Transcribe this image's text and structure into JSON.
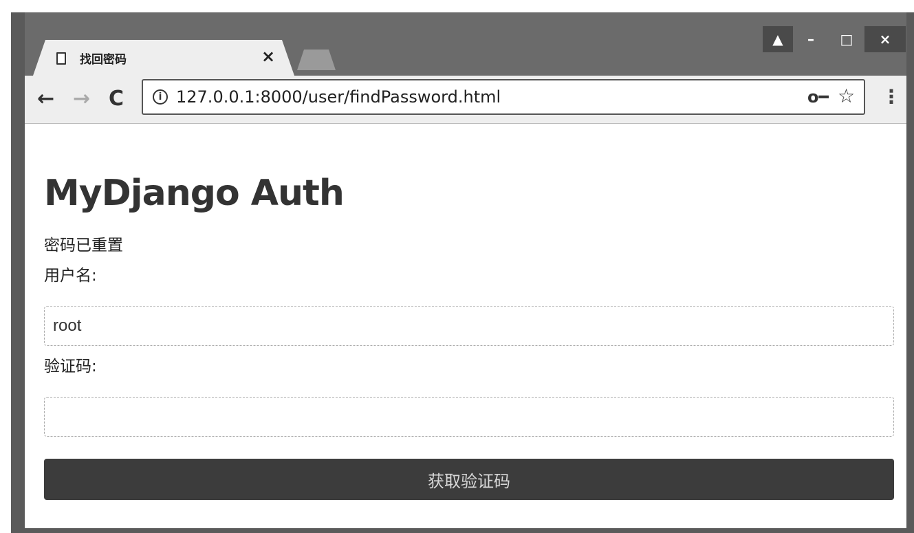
{
  "browser": {
    "tab_title": "找回密码",
    "tab_close": "×",
    "url": "127.0.0.1:8000/user/findPassword.html",
    "icons": {
      "page": "page-icon",
      "back": "back-arrow-icon",
      "forward": "forward-arrow-icon",
      "reload": "reload-icon",
      "info": "info-icon",
      "key": "key-icon",
      "star": "star-icon",
      "menu": "menu-dots-icon"
    },
    "glyphs": {
      "back": "←",
      "forward": "→",
      "reload": "C",
      "info": "i",
      "key": "o━",
      "star": "☆",
      "menu": "⋮",
      "win_user": "▲",
      "win_min": "–",
      "win_max": "□",
      "win_close": "×"
    }
  },
  "page": {
    "title": "MyDjango Auth",
    "message": "密码已重置",
    "username_label": "用户名:",
    "username_value": "root",
    "code_label": "验证码:",
    "code_value": "",
    "submit_label": "获取验证码"
  },
  "colors": {
    "button_bg": "#3c3c3c",
    "button_text": "#d8d8d8",
    "frame": "#5a5a5a"
  }
}
